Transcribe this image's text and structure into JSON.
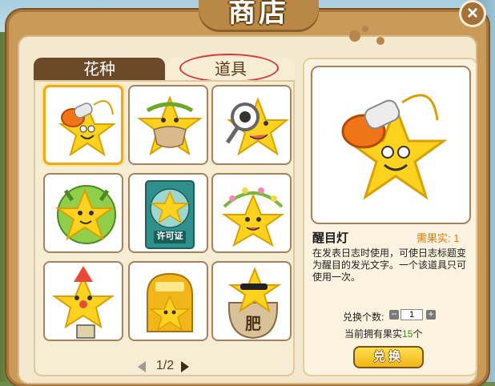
{
  "dialog": {
    "title": "商店",
    "close_label": "×"
  },
  "tabs": [
    {
      "label": "花种",
      "active": false
    },
    {
      "label": "道具",
      "active": true
    }
  ],
  "items": [
    {
      "icon": "star-with-lamp-icon",
      "selected": true
    },
    {
      "icon": "star-with-laurel-mask-icon",
      "selected": false
    },
    {
      "icon": "star-with-magnifier-icon",
      "selected": false
    },
    {
      "icon": "star-with-horns-icon",
      "selected": false
    },
    {
      "icon": "permit-card-icon",
      "card_text": "许可证",
      "selected": false
    },
    {
      "icon": "star-with-flower-crown-icon",
      "selected": false
    },
    {
      "icon": "clown-star-icon",
      "selected": false
    },
    {
      "icon": "golden-bell-star-icon",
      "selected": false
    },
    {
      "icon": "fertilizer-bag-star-icon",
      "bag_text": "肥",
      "selected": false
    }
  ],
  "pager": {
    "text": "1/2"
  },
  "detail": {
    "name": "醒目灯",
    "need_label": "需果实:",
    "need_value": "1",
    "description": "在发表日志时使用，可使日志标题变为醒目的发光文字。一个该道具只可使用一次。",
    "qty_label": "兑换个数:",
    "qty_value": "1",
    "owned_prefix": "当前拥有果实",
    "owned_count": "15",
    "owned_suffix": "个",
    "exchange_label": "兑换"
  },
  "colors": {
    "accent": "#f1a81c",
    "frame": "#c99a58",
    "tab_active_outline": "#d4383a",
    "owned_number": "#2f8f12"
  }
}
